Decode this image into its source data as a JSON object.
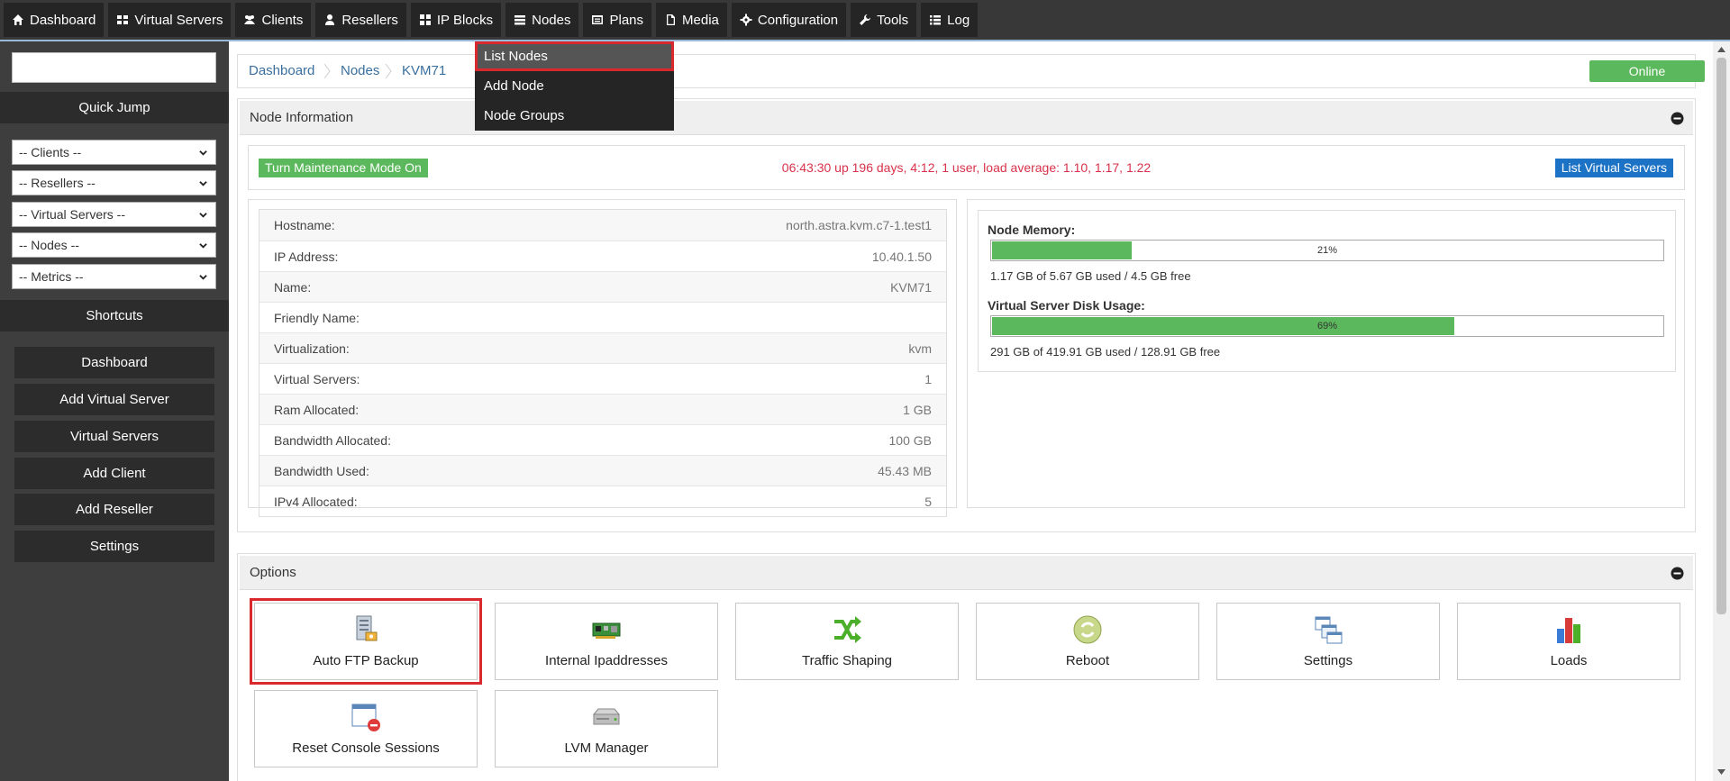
{
  "nav": {
    "items": [
      {
        "label": "Dashboard",
        "icon": "home-icon"
      },
      {
        "label": "Virtual Servers",
        "icon": "grid-icon"
      },
      {
        "label": "Clients",
        "icon": "users-icon"
      },
      {
        "label": "Resellers",
        "icon": "user-icon"
      },
      {
        "label": "IP Blocks",
        "icon": "blocks-icon"
      },
      {
        "label": "Nodes",
        "icon": "server-icon"
      },
      {
        "label": "Plans",
        "icon": "plans-icon"
      },
      {
        "label": "Media",
        "icon": "file-icon"
      },
      {
        "label": "Configuration",
        "icon": "gear-icon"
      },
      {
        "label": "Tools",
        "icon": "wrench-icon"
      },
      {
        "label": "Log",
        "icon": "list-icon"
      }
    ],
    "nodes_menu": [
      {
        "label": "List Nodes"
      },
      {
        "label": "Add Node"
      },
      {
        "label": "Node Groups"
      }
    ]
  },
  "sidebar": {
    "search_value": "",
    "quick_jump_title": "Quick Jump",
    "selects": [
      {
        "value": "-- Clients --"
      },
      {
        "value": "-- Resellers --"
      },
      {
        "value": "-- Virtual Servers --"
      },
      {
        "value": "-- Nodes --"
      },
      {
        "value": "-- Metrics --"
      }
    ],
    "shortcuts_title": "Shortcuts",
    "shortcuts": [
      {
        "label": "Dashboard"
      },
      {
        "label": "Add Virtual Server"
      },
      {
        "label": "Virtual Servers"
      },
      {
        "label": "Add Client"
      },
      {
        "label": "Add Reseller"
      },
      {
        "label": "Settings"
      }
    ]
  },
  "breadcrumb": {
    "items": [
      {
        "label": "Dashboard"
      },
      {
        "label": "Nodes"
      },
      {
        "label": "KVM71"
      }
    ],
    "status": "Online"
  },
  "node_info": {
    "title": "Node Information",
    "maintenance_button": "Turn Maintenance Mode On",
    "uptime": "06:43:30 up 196 days, 4:12, 1 user, load average: 1.10, 1.17, 1.22",
    "list_vs_button": "List Virtual Servers",
    "rows": [
      {
        "label": "Hostname:",
        "value": "north.astra.kvm.c7-1.test1"
      },
      {
        "label": "IP Address:",
        "value": "10.40.1.50"
      },
      {
        "label": "Name:",
        "value": "KVM71"
      },
      {
        "label": "Friendly Name:",
        "value": ""
      },
      {
        "label": "Virtualization:",
        "value": "kvm"
      },
      {
        "label": "Virtual Servers:",
        "value": "1"
      },
      {
        "label": "Ram Allocated:",
        "value": "1 GB"
      },
      {
        "label": "Bandwidth Allocated:",
        "value": "100 GB"
      },
      {
        "label": "Bandwidth Used:",
        "value": "45.43 MB"
      },
      {
        "label": "IPv4 Allocated:",
        "value": "5"
      }
    ],
    "memory": {
      "title": "Node Memory:",
      "percent": 21,
      "percent_label": "21%",
      "text": "1.17 GB of 5.67 GB used / 4.5 GB free"
    },
    "disk": {
      "title": "Virtual Server Disk Usage:",
      "percent": 69,
      "percent_label": "69%",
      "text": "291 GB of 419.91 GB used / 128.91 GB free"
    }
  },
  "options": {
    "title": "Options",
    "tiles": [
      {
        "label": "Auto FTP Backup",
        "icon": "ftp-backup-icon"
      },
      {
        "label": "Internal Ipaddresses",
        "icon": "network-card-icon"
      },
      {
        "label": "Traffic Shaping",
        "icon": "shuffle-arrows-icon"
      },
      {
        "label": "Reboot",
        "icon": "reboot-icon"
      },
      {
        "label": "Settings",
        "icon": "settings-windows-icon"
      },
      {
        "label": "Loads",
        "icon": "bar-chart-icon"
      },
      {
        "label": "Reset Console Sessions",
        "icon": "console-reset-icon"
      },
      {
        "label": "LVM Manager",
        "icon": "disk-drive-icon"
      }
    ]
  },
  "colors": {
    "accent_green": "#5cb85c",
    "accent_blue": "#1c72c4",
    "uptime_red": "#d9324a",
    "highlight_red": "#d9292f"
  }
}
